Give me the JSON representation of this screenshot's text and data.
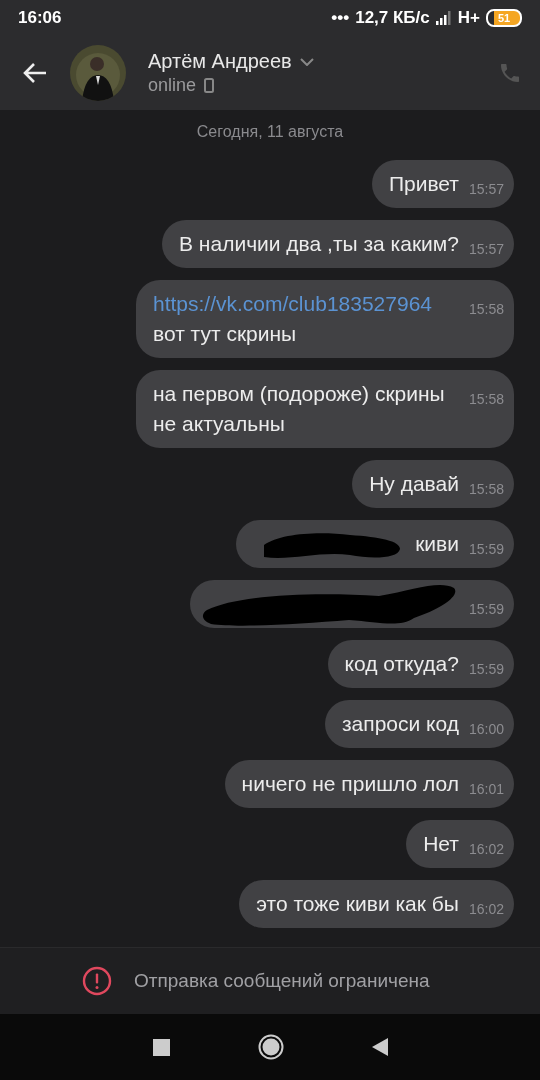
{
  "status_bar": {
    "time": "16:06",
    "dots": "•••",
    "speed": "12,7 КБ/с",
    "network": "H+",
    "battery": "51"
  },
  "header": {
    "name": "Артём Андреев",
    "status": "online"
  },
  "date_divider": "Сегодня, 11 августа",
  "messages": [
    {
      "kind": "text",
      "parts": [
        {
          "text": "Привет",
          "link": false
        }
      ],
      "time": "15:57"
    },
    {
      "kind": "text",
      "parts": [
        {
          "text": "В наличии два ,ты за каким?",
          "link": false
        }
      ],
      "time": "15:57"
    },
    {
      "kind": "text",
      "parts": [
        {
          "text": "https://vk.com/club183527964",
          "link": true
        },
        {
          "text": " вот тут скрины",
          "link": false
        }
      ],
      "time": "15:58"
    },
    {
      "kind": "text",
      "parts": [
        {
          "text": "на первом (подороже) скрины не актуальны",
          "link": false
        }
      ],
      "time": "15:58"
    },
    {
      "kind": "text",
      "parts": [
        {
          "text": "Ну давай",
          "link": false
        }
      ],
      "time": "15:58"
    },
    {
      "kind": "redacted",
      "parts": [
        {
          "text": "киви",
          "link": false
        }
      ],
      "time": "15:59"
    },
    {
      "kind": "redacted",
      "time": "15:59"
    },
    {
      "kind": "text",
      "parts": [
        {
          "text": "код откуда?",
          "link": false
        }
      ],
      "time": "15:59"
    },
    {
      "kind": "text",
      "parts": [
        {
          "text": "запроси код",
          "link": false
        }
      ],
      "time": "16:00"
    },
    {
      "kind": "text",
      "parts": [
        {
          "text": "ничего не пришло лол",
          "link": false
        }
      ],
      "time": "16:01"
    },
    {
      "kind": "text",
      "parts": [
        {
          "text": "Нет",
          "link": false
        }
      ],
      "time": "16:02"
    },
    {
      "kind": "text",
      "parts": [
        {
          "text": "это тоже киви как бы",
          "link": false
        }
      ],
      "time": "16:02"
    }
  ],
  "notice": "Отправка сообщений ограничена"
}
